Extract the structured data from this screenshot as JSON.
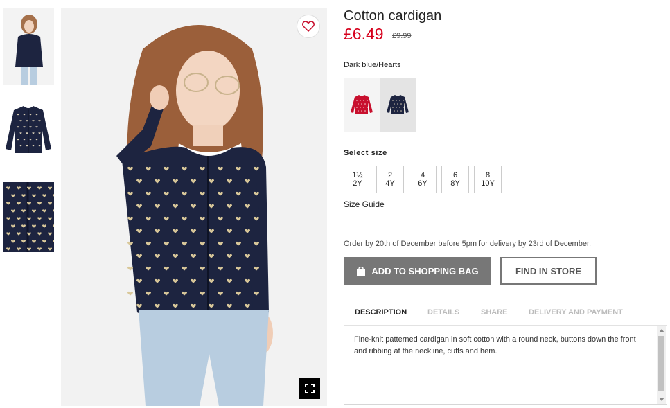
{
  "thumbnails": [
    {
      "name": "thumbnail-model-front",
      "icon": "model-photo"
    },
    {
      "name": "thumbnail-flat-front",
      "icon": "cardigan-photo"
    },
    {
      "name": "thumbnail-fabric-detail",
      "icon": "fabric-photo"
    }
  ],
  "main_image": {
    "favorite_icon": "heart-icon",
    "zoom_icon": "fullscreen-icon"
  },
  "product": {
    "title": "Cotton cardigan",
    "price": "£6.49",
    "old_price": "£9.99",
    "color_name": "Dark blue/Hearts"
  },
  "swatches": [
    {
      "name": "swatch-red",
      "color": "#c8102e"
    },
    {
      "name": "swatch-dark-blue",
      "color": "#1d2440"
    }
  ],
  "sizes": {
    "label": "Select size",
    "options": [
      {
        "line1": "1½",
        "line2": "2Y"
      },
      {
        "line1": "2",
        "line2": "4Y"
      },
      {
        "line1": "4",
        "line2": "6Y"
      },
      {
        "line1": "6",
        "line2": "8Y"
      },
      {
        "line1": "8",
        "line2": "10Y"
      }
    ],
    "guide_label": "Size Guide"
  },
  "delivery_note": "Order by 20th of December before 5pm for delivery by 23rd of December.",
  "actions": {
    "add_to_bag": "ADD TO SHOPPING BAG",
    "find_in_store": "FIND IN STORE"
  },
  "tabs": [
    {
      "label": "DESCRIPTION",
      "active": true
    },
    {
      "label": "DETAILS",
      "active": false
    },
    {
      "label": "SHARE",
      "active": false
    },
    {
      "label": "DELIVERY AND PAYMENT",
      "active": false
    }
  ],
  "description_text": "Fine-knit patterned cardigan in soft cotton with a round neck, buttons down the front and ribbing at the neckline, cuffs and hem.",
  "colors": {
    "price_red": "#d6001c",
    "button_grey": "#777777",
    "navy": "#1d2440"
  }
}
